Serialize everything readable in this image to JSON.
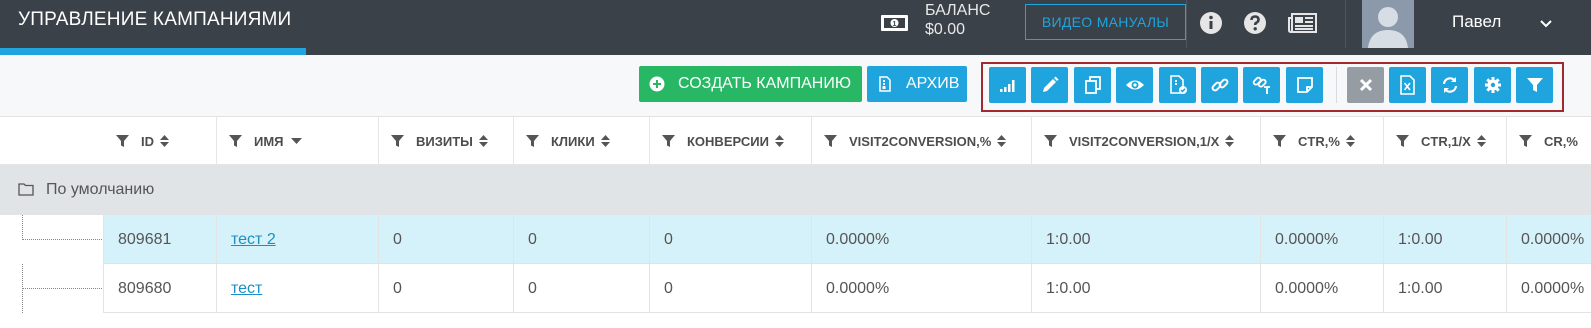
{
  "header": {
    "title": "УПРАВЛЕНИЕ КАМПАНИЯМИ",
    "balance_label": "БАЛАНС",
    "balance_value": "$0.00",
    "video_manuals": "ВИДЕО МАНУАЛЫ",
    "user_name": "Павел",
    "accent_color": "#1fa4dd"
  },
  "toolbar": {
    "create_label": "СОЗДАТЬ КАМПАНИЮ",
    "archive_label": "АРХИВ",
    "action_icons": [
      "signal-bars-icon",
      "pencil-icon",
      "copy-icon",
      "eye-icon",
      "document-check-icon",
      "link-icon",
      "link-text-icon",
      "note-icon"
    ],
    "utility_icons": [
      "close-icon",
      "excel-icon",
      "refresh-icon",
      "gear-icon",
      "filter-icon"
    ]
  },
  "table": {
    "columns": [
      "ID",
      "ИМЯ",
      "ВИЗИТЫ",
      "КЛИКИ",
      "КОНВЕРСИИ",
      "VISIT2CONVERSION,%",
      "VISIT2CONVERSION,1/X",
      "CTR,%",
      "CTR,1/X",
      "CR,%"
    ],
    "group_label": "По умолчанию",
    "rows": [
      {
        "id": "809681",
        "name": "тест 2",
        "visits": "0",
        "clicks": "0",
        "conversions": "0",
        "v2c_pct": "0.0000%",
        "v2c_ratio": "1:0.00",
        "ctr_pct": "0.0000%",
        "ctr_ratio": "1:0.00",
        "cr_pct": "0.0000%"
      },
      {
        "id": "809680",
        "name": "тест",
        "visits": "0",
        "clicks": "0",
        "conversions": "0",
        "v2c_pct": "0.0000%",
        "v2c_ratio": "1:0.00",
        "ctr_pct": "0.0000%",
        "ctr_ratio": "1:0.00",
        "cr_pct": "0.0000%"
      }
    ]
  }
}
